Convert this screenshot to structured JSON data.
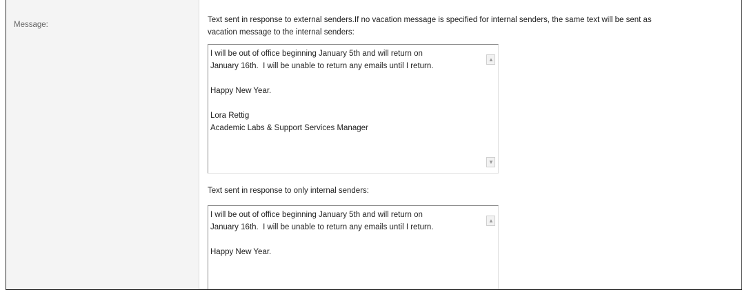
{
  "form": {
    "message_label": "Message:",
    "external": {
      "description_line1": "Text sent in response to external senders.If no vacation message is specified for internal senders, the same text will be sent as",
      "description_line2": "vacation message to the internal senders:",
      "text": "I will be out of office beginning January 5th and will return on\nJanuary 16th.  I will be unable to return any emails until I return.\n\nHappy New Year.\n\nLora Rettig\nAcademic Labs & Support Services Manager"
    },
    "internal": {
      "description": "Text sent in response to only internal senders:",
      "text": "I will be out of office beginning January 5th and will return on\nJanuary 16th.  I will be unable to return any emails until I return.\n\nHappy New Year."
    }
  },
  "icons": {
    "scroll_up": "scroll-up-arrow",
    "scroll_down": "scroll-down-arrow"
  }
}
